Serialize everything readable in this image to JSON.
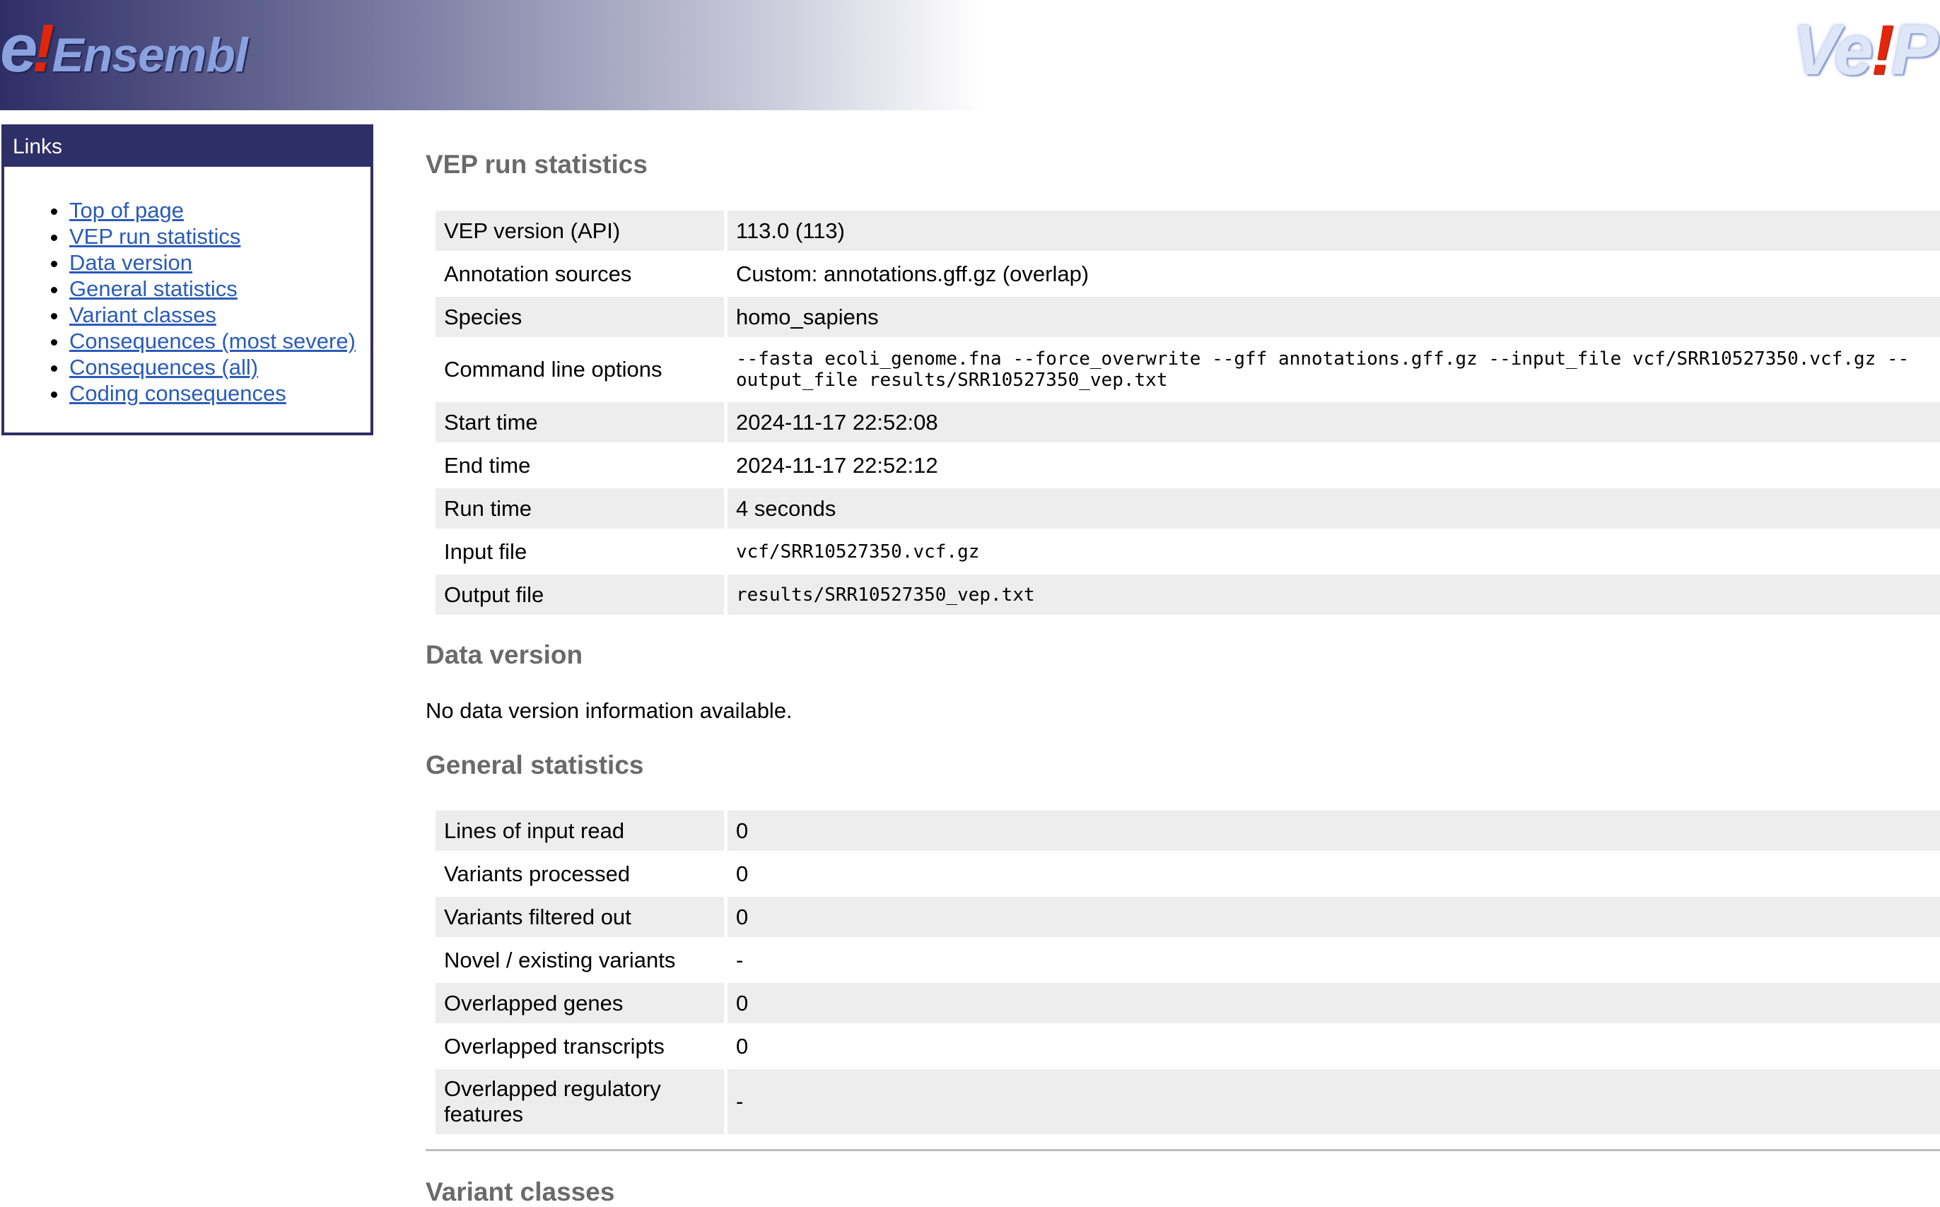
{
  "header": {
    "logo_e": "e",
    "logo_bang": "!",
    "logo_word": "Ensembl",
    "vep_logo_pre": "Ve",
    "vep_logo_bang": "!",
    "vep_logo_post": "P"
  },
  "sidebar": {
    "title": "Links",
    "items": [
      {
        "label": "Top of page"
      },
      {
        "label": "VEP run statistics"
      },
      {
        "label": "Data version"
      },
      {
        "label": "General statistics"
      },
      {
        "label": "Variant classes"
      },
      {
        "label": "Consequences (most severe)"
      },
      {
        "label": "Consequences (all)"
      },
      {
        "label": "Coding consequences"
      }
    ]
  },
  "run_stats": {
    "heading": "VEP run statistics",
    "rows": [
      {
        "key": "VEP version (API)",
        "value": "113.0 (113)"
      },
      {
        "key": "Annotation sources",
        "value": "Custom: annotations.gff.gz (overlap)"
      },
      {
        "key": "Species",
        "value": "homo_sapiens"
      },
      {
        "key": "Command line options",
        "value": "--fasta ecoli_genome.fna --force_overwrite --gff annotations.gff.gz --input_file vcf/SRR10527350.vcf.gz --output_file results/SRR10527350_vep.txt"
      },
      {
        "key": "Start time",
        "value": "2024-11-17 22:52:08"
      },
      {
        "key": "End time",
        "value": "2024-11-17 22:52:12"
      },
      {
        "key": "Run time",
        "value": "4 seconds"
      },
      {
        "key": "Input file",
        "value": "vcf/SRR10527350.vcf.gz"
      },
      {
        "key": "Output file",
        "value": "results/SRR10527350_vep.txt"
      }
    ]
  },
  "data_version": {
    "heading": "Data version",
    "text": "No data version information available."
  },
  "general_stats": {
    "heading": "General statistics",
    "rows": [
      {
        "key": "Lines of input read",
        "value": "0"
      },
      {
        "key": "Variants processed",
        "value": "0"
      },
      {
        "key": "Variants filtered out",
        "value": "0"
      },
      {
        "key": "Novel / existing variants",
        "value": "-"
      },
      {
        "key": "Overlapped genes",
        "value": "0"
      },
      {
        "key": "Overlapped transcripts",
        "value": "0"
      },
      {
        "key": "Overlapped regulatory features",
        "value": "-"
      }
    ]
  },
  "variant_classes": {
    "heading": "Variant classes"
  }
}
